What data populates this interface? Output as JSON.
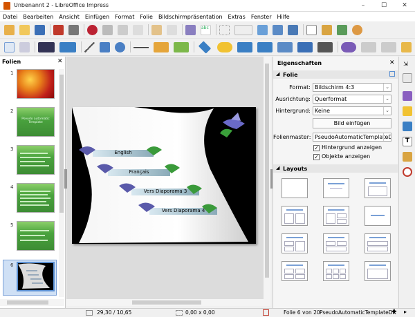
{
  "window": {
    "title": "Unbenannt 2 - LibreOffice Impress",
    "minimize": "–",
    "maximize": "☐",
    "close": "✕"
  },
  "menu": [
    "Datei",
    "Bearbeiten",
    "Ansicht",
    "Einfügen",
    "Format",
    "Folie",
    "Bildschirmpräsentation",
    "Extras",
    "Fenster",
    "Hilfe"
  ],
  "slides_panel": {
    "title": "Folien",
    "close": "✕",
    "numbers": [
      "1",
      "2",
      "3",
      "4",
      "5",
      "6"
    ],
    "thumb2_text": "Pseudo automatic Template"
  },
  "slide": {
    "labels": [
      "English",
      "Français",
      "Vers Diaporama 3",
      "Vers Diaporama 4"
    ]
  },
  "sidebar": {
    "title": "Eigenschaften",
    "close": "✕",
    "section_folie": "Folie",
    "format_label": "Format:",
    "format_value": "Bildschirm 4:3",
    "orientation_label": "Ausrichtung:",
    "orientation_value": "Querformat",
    "background_label": "Hintergrund:",
    "background_value": "Keine",
    "insert_image": "Bild einfügen",
    "master_label": "Folienmaster:",
    "master_value": "PseudoAutomaticTemplateDR",
    "show_bg": "Hintergrund anzeigen",
    "show_objects": "Objekte anzeigen",
    "section_layouts": "Layouts"
  },
  "status": {
    "position": "29,30 / 10,65",
    "size": "0,00 x 0,00",
    "slide": "Folie 6 von 20",
    "master": "PseudoAutomaticTemplateDR"
  },
  "colors": {
    "accent": "#5a8fd1",
    "green": "#4aa33e",
    "dark": "#000000"
  }
}
